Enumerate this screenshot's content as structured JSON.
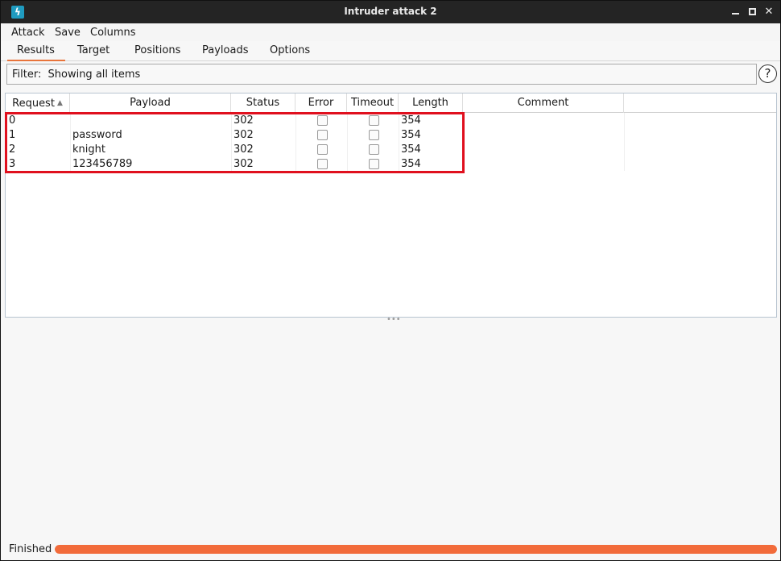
{
  "window": {
    "title": "Intruder attack 2",
    "icon": "burp-lightning-icon",
    "accent": "#e8743b"
  },
  "menu": [
    "Attack",
    "Save",
    "Columns"
  ],
  "tabs": [
    {
      "label": "Results",
      "active": true
    },
    {
      "label": "Target",
      "active": false
    },
    {
      "label": "Positions",
      "active": false
    },
    {
      "label": "Payloads",
      "active": false
    },
    {
      "label": "Options",
      "active": false
    }
  ],
  "filter": {
    "label": "Filter:",
    "value": "Showing all items",
    "help": "?"
  },
  "table": {
    "columns": [
      "Request",
      "Payload",
      "Status",
      "Error",
      "Timeout",
      "Length",
      "Comment"
    ],
    "sort_column": "Request",
    "sort_direction": "ascending",
    "rows": [
      {
        "request": "0",
        "payload": "",
        "status": "302",
        "error": false,
        "timeout": false,
        "length": "354",
        "comment": ""
      },
      {
        "request": "1",
        "payload": "password",
        "status": "302",
        "error": false,
        "timeout": false,
        "length": "354",
        "comment": ""
      },
      {
        "request": "2",
        "payload": "knight",
        "status": "302",
        "error": false,
        "timeout": false,
        "length": "354",
        "comment": ""
      },
      {
        "request": "3",
        "payload": "123456789",
        "status": "302",
        "error": false,
        "timeout": false,
        "length": "354",
        "comment": ""
      }
    ],
    "highlight_color": "#e0101e"
  },
  "status": {
    "text": "Finished",
    "progress": 1.0,
    "progress_color": "#f26b3a"
  }
}
